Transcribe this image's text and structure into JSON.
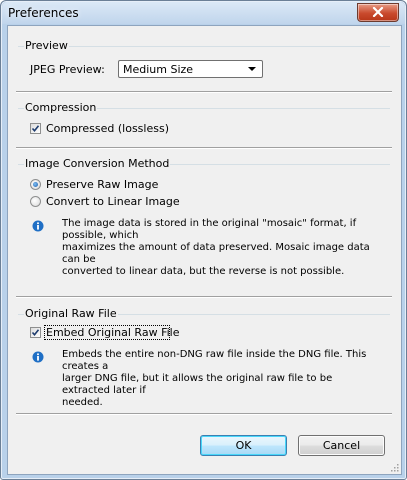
{
  "window": {
    "title": "Preferences",
    "close_icon": "close-icon"
  },
  "preview": {
    "legend": "Preview",
    "jpeg_label": "JPEG Preview:",
    "jpeg_value": "Medium Size"
  },
  "compression": {
    "legend": "Compression",
    "checkbox_label": "Compressed (lossless)",
    "checked": true
  },
  "conversion": {
    "legend": "Image Conversion Method",
    "options": [
      {
        "label": "Preserve Raw Image",
        "selected": true
      },
      {
        "label": "Convert to Linear Image",
        "selected": false
      }
    ],
    "info_lines": [
      "The image data is stored in the original \"mosaic\" format, if possible, which",
      "maximizes the amount of data preserved.  Mosaic image data can be",
      "converted to linear data, but the reverse is not possible."
    ]
  },
  "original_raw": {
    "legend": "Original Raw File",
    "checkbox_label": "Embed Original Raw File",
    "checked": true,
    "info_lines": [
      "Embeds the entire non-DNG raw file inside the DNG file.  This creates a",
      "larger DNG file, but it allows the original raw file to be extracted later if",
      "needed."
    ]
  },
  "buttons": {
    "ok": "OK",
    "cancel": "Cancel"
  },
  "colors": {
    "window_frame": "#b9d1ea",
    "client_bg": "#f0f0f0",
    "close_button": "#c94a2d",
    "info_icon": "#1f6fc5"
  }
}
